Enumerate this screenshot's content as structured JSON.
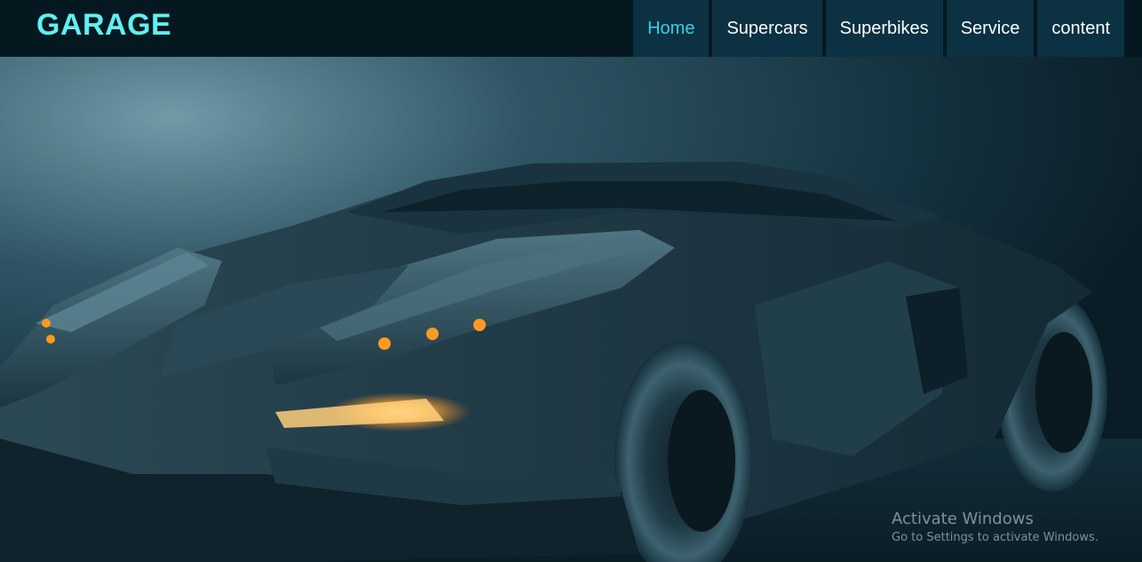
{
  "header": {
    "logo": "GARAGE",
    "nav": [
      {
        "label": "Home",
        "active": true
      },
      {
        "label": "Supercars",
        "active": false
      },
      {
        "label": "Superbikes",
        "active": false
      },
      {
        "label": "Service",
        "active": false
      },
      {
        "label": "content",
        "active": false
      }
    ]
  },
  "hero": {
    "image": "dark armored supercar with glowing orange headlights"
  },
  "watermark": {
    "title": "Activate Windows",
    "subtitle": "Go to Settings to activate Windows."
  },
  "colors": {
    "navbar_bg": "#051820",
    "nav_item_bg": "#0b3143",
    "logo": "#5ff0f0",
    "active_link": "#33d2e0",
    "headlight": "#ff9a1e"
  }
}
